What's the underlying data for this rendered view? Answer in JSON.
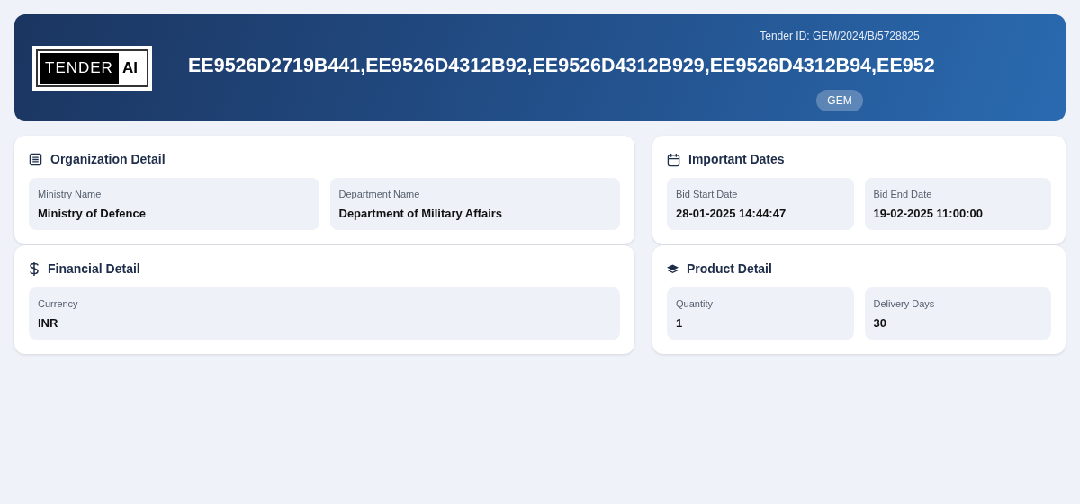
{
  "header": {
    "logo": {
      "word": "TENDER",
      "accent": "AI"
    },
    "tender_id": "Tender ID: GEM/2024/B/5728825",
    "title": "EE9526D2719B441,EE9526D4312B92,EE9526D4312B929,EE9526D4312B94,EE952",
    "badge": "GEM"
  },
  "sections": [
    {
      "kind": "list",
      "title": "Organization Detail",
      "fields": [
        {
          "label": "Ministry Name",
          "value": "Ministry of Defence"
        },
        {
          "label": "Department Name",
          "value": "Department of Military Affairs"
        }
      ]
    },
    {
      "kind": "calendar",
      "title": "Important Dates",
      "fields": [
        {
          "label": "Bid Start Date",
          "value": "28-01-2025 14:44:47"
        },
        {
          "label": "Bid End Date",
          "value": "19-02-2025 11:00:00"
        }
      ]
    },
    {
      "kind": "dollar",
      "title": "Financial Detail",
      "fields": [
        {
          "label": "Currency",
          "value": "INR"
        }
      ]
    },
    {
      "kind": "layers",
      "title": "Product Detail",
      "fields": [
        {
          "label": "Quantity",
          "value": "1"
        },
        {
          "label": "Delivery Days",
          "value": "30"
        }
      ]
    }
  ]
}
